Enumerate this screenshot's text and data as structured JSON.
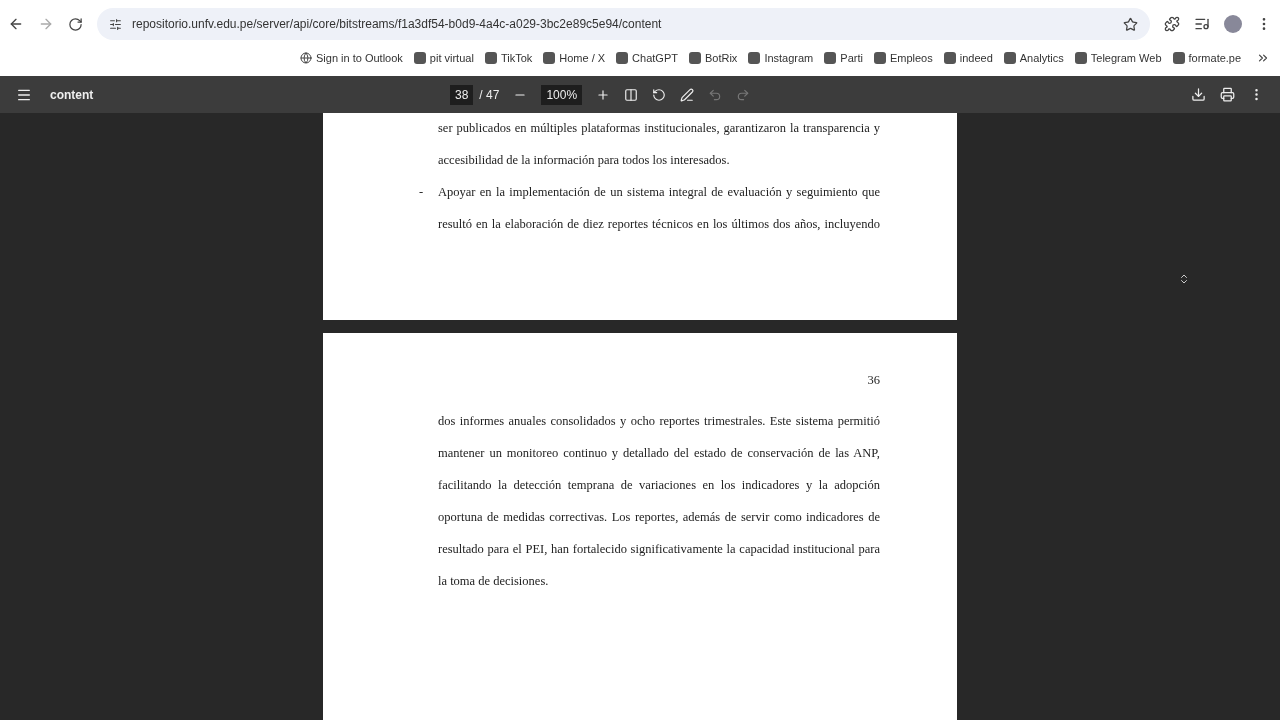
{
  "browser": {
    "url": "repositorio.unfv.edu.pe/server/api/core/bitstreams/f1a3df54-b0d9-4a4c-a029-3bc2e89c5e94/content"
  },
  "bookmarks": [
    {
      "label": "Sign in to Outlook"
    },
    {
      "label": "pit virtual"
    },
    {
      "label": "TikTok"
    },
    {
      "label": "Home / X"
    },
    {
      "label": "ChatGPT"
    },
    {
      "label": "BotRix"
    },
    {
      "label": "Instagram"
    },
    {
      "label": "Parti"
    },
    {
      "label": "Empleos"
    },
    {
      "label": "indeed"
    },
    {
      "label": "Analytics"
    },
    {
      "label": "Telegram Web"
    },
    {
      "label": "formate.pe"
    }
  ],
  "pdf_toolbar": {
    "title": "content",
    "page": "38",
    "page_total": "/ 47",
    "zoom": "100%"
  },
  "pages": [
    {
      "kind": "continuation",
      "lines": [
        {
          "text": "ser publicados en múltiples plataformas institucionales, garantizaron la transparencia y"
        },
        {
          "text": "accesibilidad de la información para todos los interesados."
        },
        {
          "bullet": "-",
          "text": "Apoyar en la implementación de un sistema integral de evaluación y seguimiento que"
        },
        {
          "text": "resultó en la elaboración de diez reportes técnicos en los últimos dos años, incluyendo"
        }
      ]
    },
    {
      "kind": "numbered",
      "page_number": "36",
      "lines": [
        {
          "text": "dos informes anuales consolidados y ocho reportes trimestrales. Este sistema permitió"
        },
        {
          "text": "mantener un monitoreo continuo y detallado del estado de conservación de las ANP,"
        },
        {
          "text": "facilitando la detección temprana de variaciones en los indicadores y la adopción"
        },
        {
          "text": "oportuna de medidas correctivas. Los reportes, además de servir como indicadores de"
        },
        {
          "text": "resultado para el PEI, han fortalecido significativamente la capacidad institucional para"
        },
        {
          "text": "la toma de decisiones."
        }
      ]
    }
  ]
}
